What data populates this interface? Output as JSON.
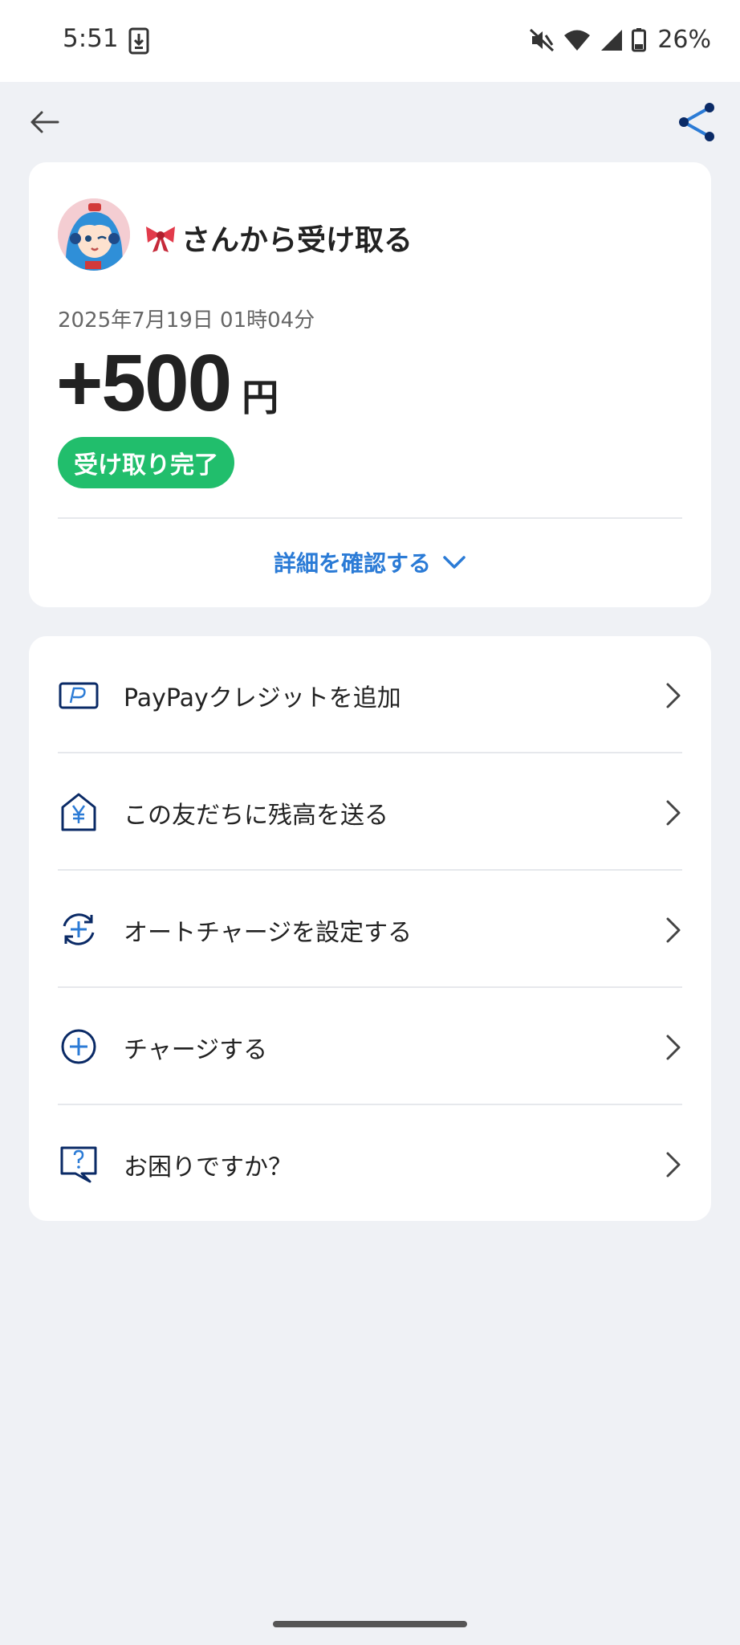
{
  "status_bar": {
    "time": "5:51",
    "battery": "26%"
  },
  "sender_title": "さんから受け取る",
  "datetime": "2025年7月19日 01時04分",
  "amount": "+500",
  "amount_unit": "円",
  "status_badge": "受け取り完了",
  "details_label": "詳細を確認する",
  "menu": [
    {
      "label": "PayPayクレジットを追加",
      "icon": "paypay-card-icon"
    },
    {
      "label": "この友だちに残高を送る",
      "icon": "yen-house-icon"
    },
    {
      "label": "オートチャージを設定する",
      "icon": "auto-charge-icon"
    },
    {
      "label": "チャージする",
      "icon": "plus-circle-icon"
    },
    {
      "label": "お困りですか？",
      "icon": "help-bubble-icon"
    }
  ],
  "colors": {
    "accent": "#2b7bd6",
    "success": "#21be6c",
    "icon_navy": "#0a2a66",
    "background": "#eff1f5"
  }
}
